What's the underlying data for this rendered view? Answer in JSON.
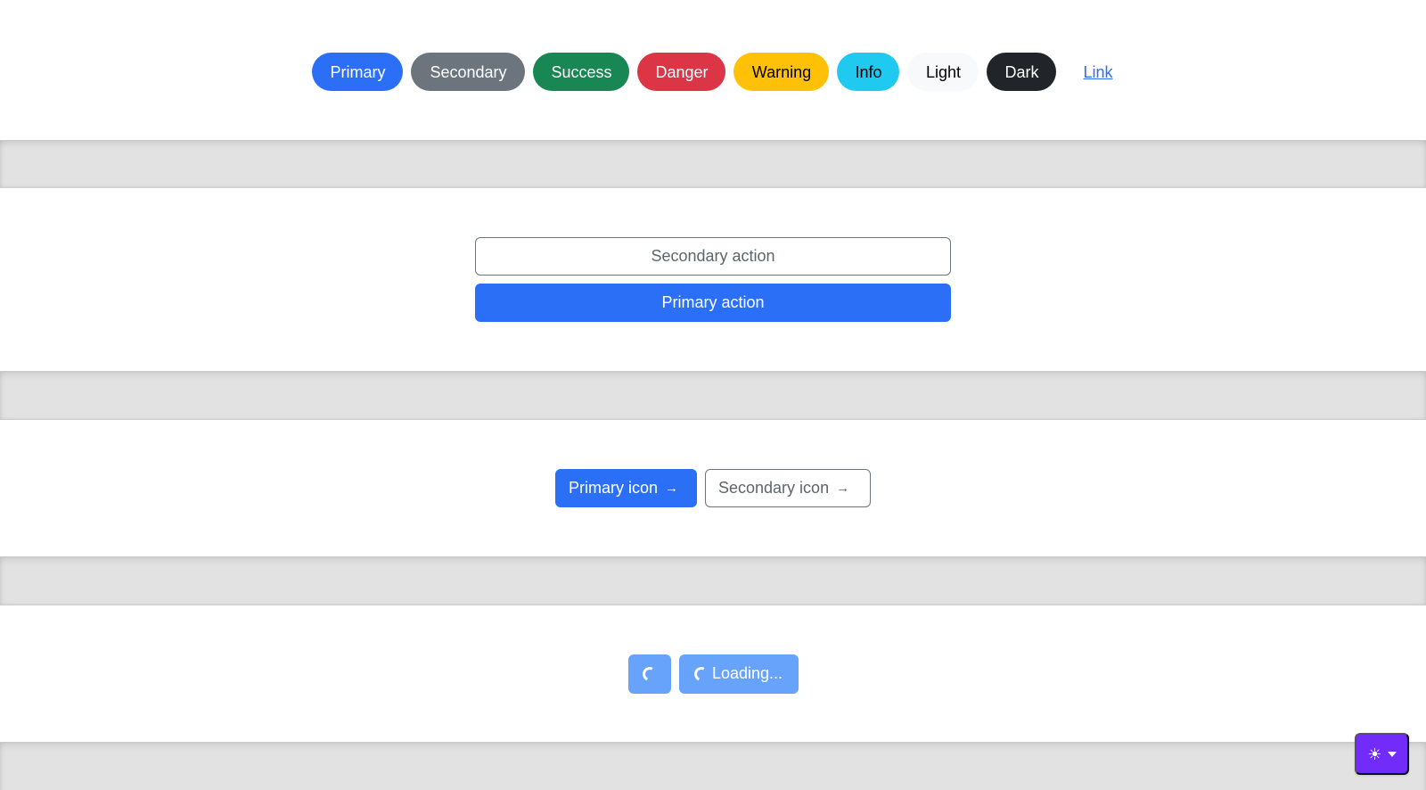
{
  "pills": [
    {
      "label": "Primary",
      "variant": "primary",
      "color": "#2b6ff7"
    },
    {
      "label": "Secondary",
      "variant": "secondary",
      "color": "#6c757d"
    },
    {
      "label": "Success",
      "variant": "success",
      "color": "#198754"
    },
    {
      "label": "Danger",
      "variant": "danger",
      "color": "#dc3545"
    },
    {
      "label": "Warning",
      "variant": "warning",
      "color": "#ffc107"
    },
    {
      "label": "Info",
      "variant": "info",
      "color": "#20c9ef"
    },
    {
      "label": "Light",
      "variant": "light",
      "color": "#f8f9fa"
    },
    {
      "label": "Dark",
      "variant": "dark",
      "color": "#212529"
    },
    {
      "label": "Link",
      "variant": "link",
      "color": "#2b6ff7"
    }
  ],
  "actions": {
    "secondary_label": "Secondary action",
    "primary_label": "Primary action"
  },
  "icon_buttons": {
    "primary_label": "Primary icon",
    "secondary_label": "Secondary icon",
    "icon": "arrow-right-icon",
    "arrow_glyph": "→"
  },
  "loading": {
    "label": "Loading...",
    "icon": "spinner-icon",
    "disabled": true
  },
  "theme_toggle": {
    "icon": "sun-icon",
    "glyph": "☀",
    "accent": "#712cf9"
  }
}
